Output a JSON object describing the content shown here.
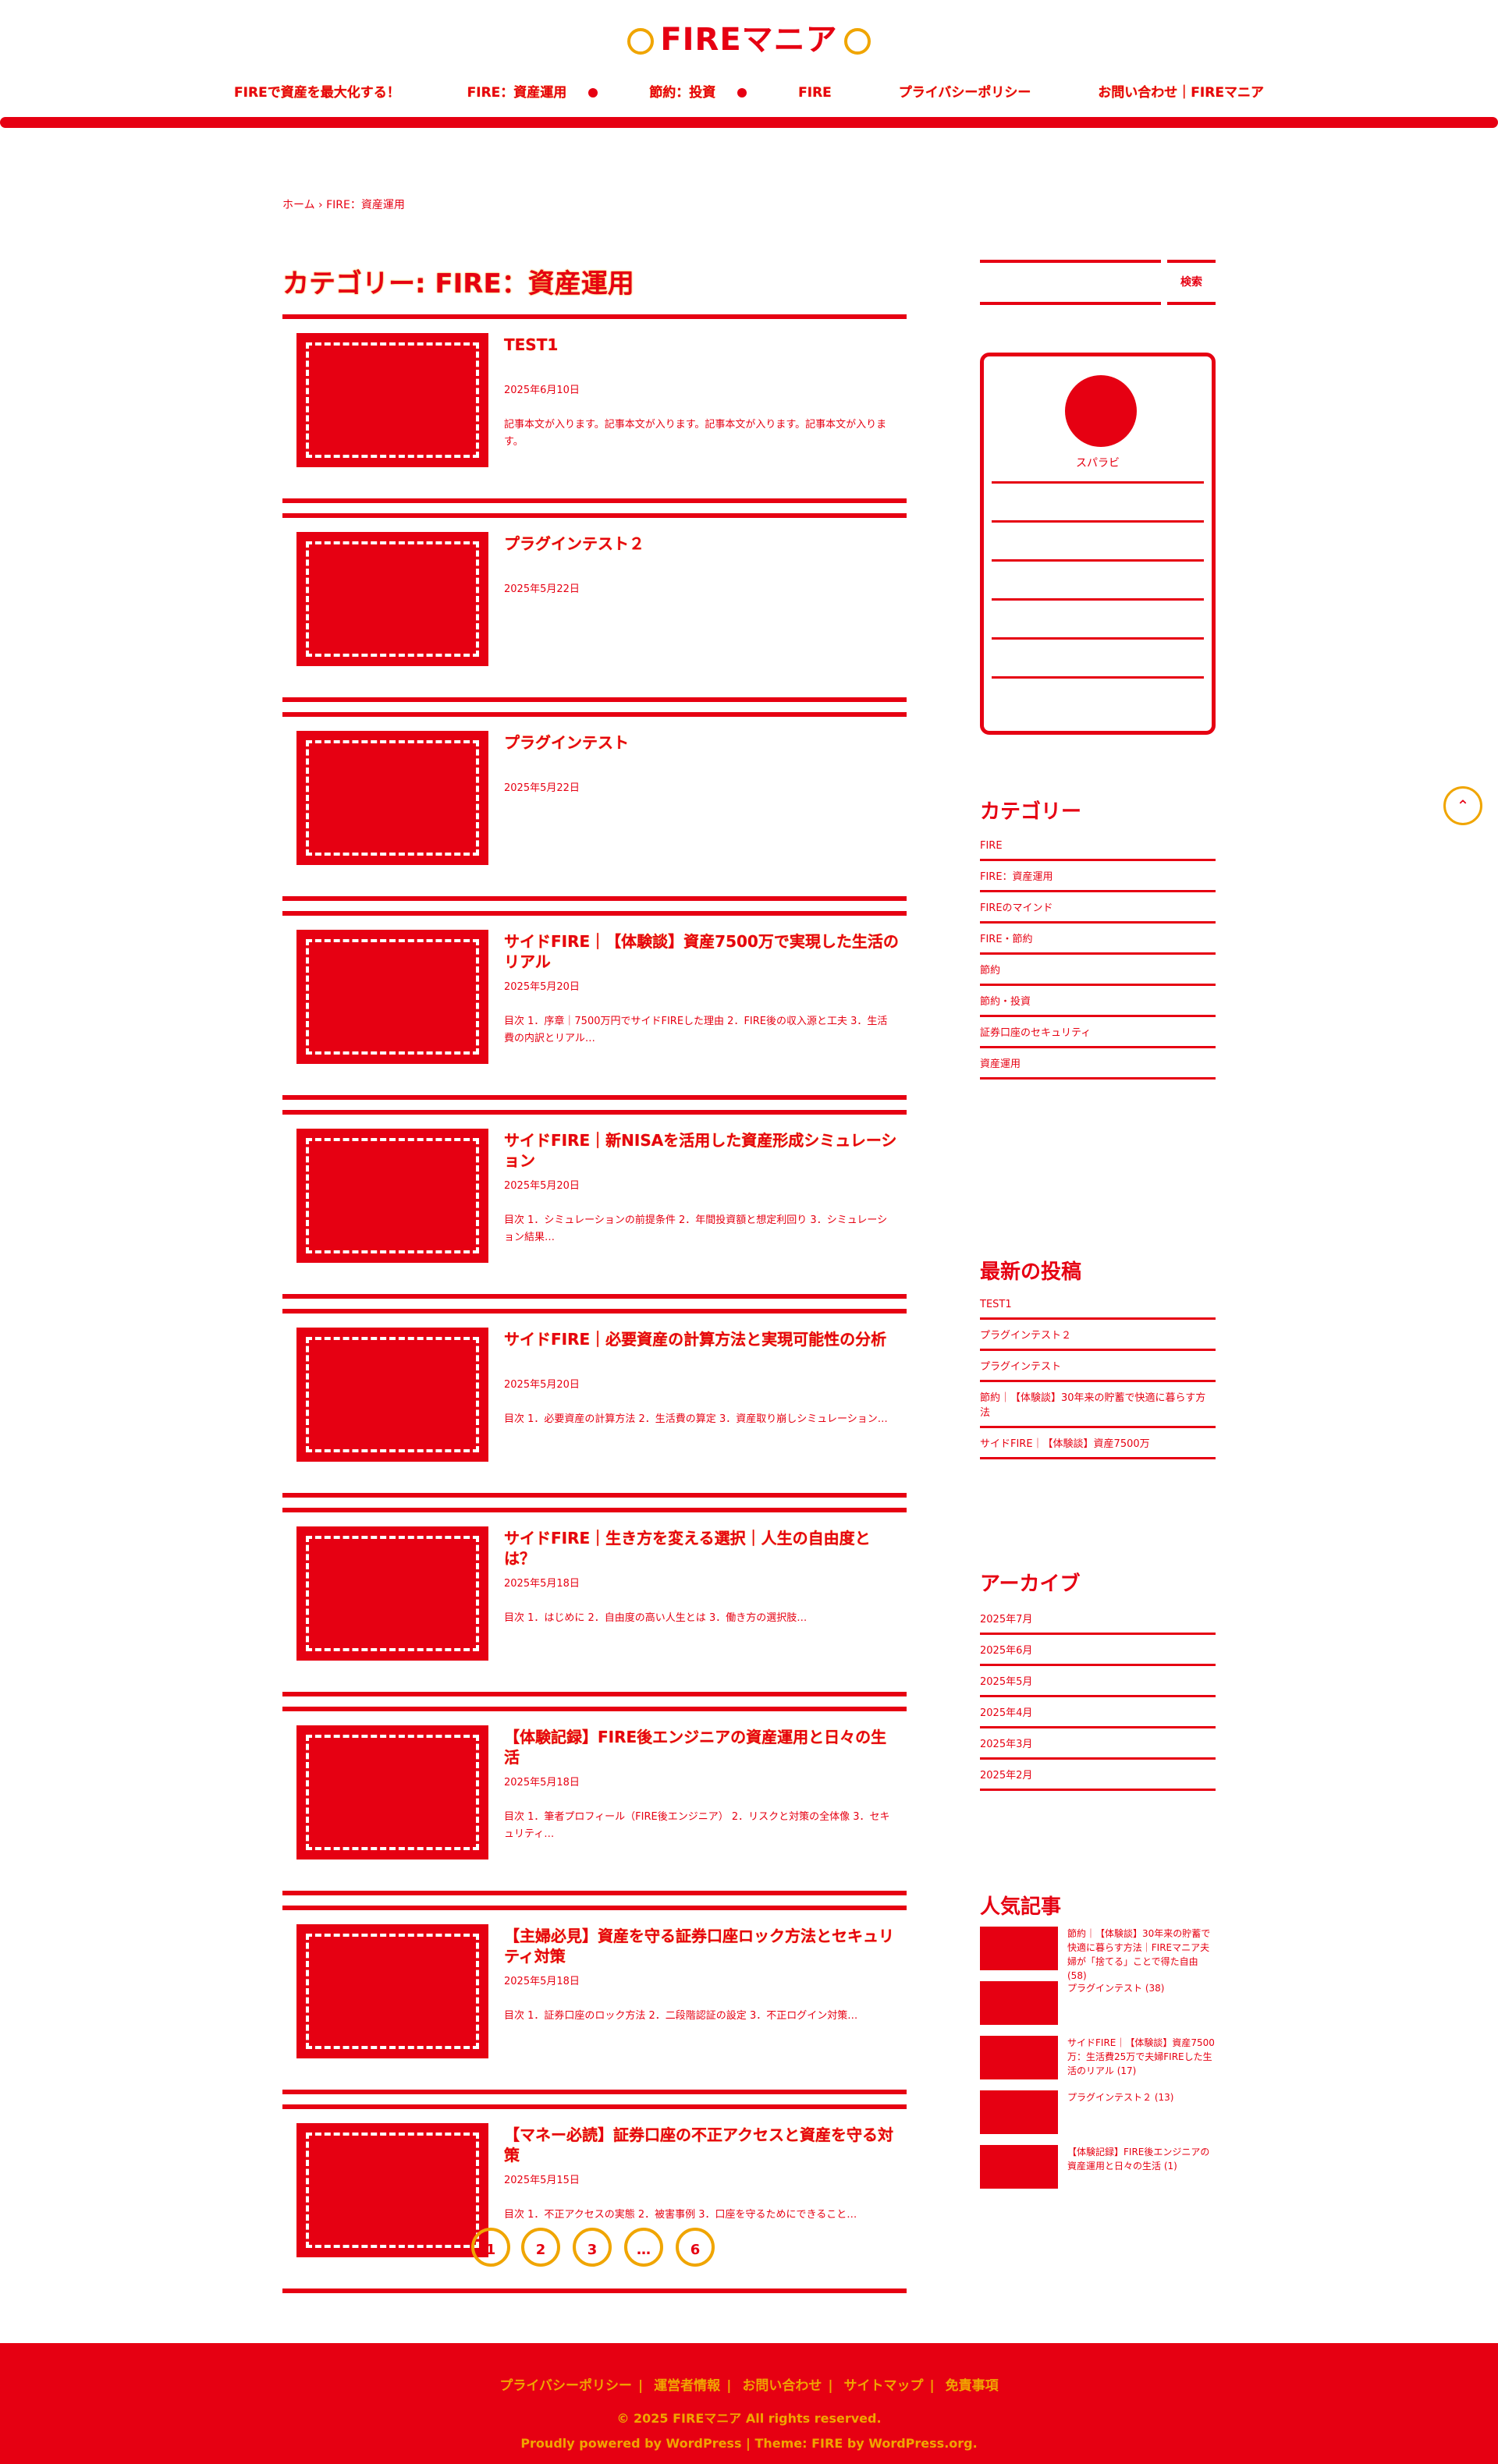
{
  "site": {
    "logo": "FIREマニア"
  },
  "nav": [
    {
      "label": "FIREで資産を最大化する！"
    },
    {
      "label": "FIRE：資産運用",
      "has_dropdown": true
    },
    {
      "label": "節約：投資",
      "has_dropdown": true
    },
    {
      "label": "FIRE"
    },
    {
      "label": "プライバシーポリシー"
    },
    {
      "label": "お問い合わせ｜FIREマニア"
    }
  ],
  "breadcrumb": {
    "home": "ホーム",
    "sep": "›",
    "current": "FIRE：資産運用"
  },
  "category_title": "カテゴリー: FIRE：資産運用",
  "posts": [
    {
      "title": "TEST1",
      "date": "2025年6月10日",
      "excerpt": "記事本文が入ります。記事本文が入ります。記事本文が入ります。記事本文が入ります。"
    },
    {
      "title": "プラグインテスト２",
      "date": "2025年5月22日",
      "excerpt": ""
    },
    {
      "title": "プラグインテスト",
      "date": "2025年5月22日",
      "excerpt": ""
    },
    {
      "title": "サイドFIRE｜【体験談】資産7500万で実現した生活のリアル",
      "date": "2025年5月20日",
      "excerpt": "目次 1．序章｜7500万円でサイドFIREした理由 2．FIRE後の収入源と工夫 3．生活費の内訳とリアル…"
    },
    {
      "title": "サイドFIRE｜新NISAを活用した資産形成シミュレーション",
      "date": "2025年5月20日",
      "excerpt": "目次 1．シミュレーションの前提条件 2．年間投資額と想定利回り 3．シミュレーション結果…"
    },
    {
      "title": "サイドFIRE｜必要資産の計算方法と実現可能性の分析",
      "date": "2025年5月20日",
      "excerpt": "目次 1．必要資産の計算方法 2．生活費の算定 3．資産取り崩しシミュレーション…"
    },
    {
      "title": "サイドFIRE｜生き方を変える選択｜人生の自由度とは？",
      "date": "2025年5月18日",
      "excerpt": "目次 1．はじめに 2．自由度の高い人生とは 3．働き方の選択肢…"
    },
    {
      "title": "【体験記録】FIRE後エンジニアの資産運用と日々の生活",
      "date": "2025年5月18日",
      "excerpt": "目次 1．筆者プロフィール（FIRE後エンジニア） 2．リスクと対策の全体像 3．セキュリティ…"
    },
    {
      "title": "【主婦必見】資産を守る証券口座ロック方法とセキュリティ対策",
      "date": "2025年5月18日",
      "excerpt": "目次 1．証券口座のロック方法 2．二段階認証の設定 3．不正ログイン対策…"
    },
    {
      "title": "【マネー必読】証券口座の不正アクセスと資産を守る対策",
      "date": "2025年5月15日",
      "excerpt": "目次 1．不正アクセスの実態 2．被害事例 3．口座を守るためにできること…"
    }
  ],
  "pager": [
    "1",
    "2",
    "3",
    "…",
    "6"
  ],
  "sidebar": {
    "search_button": "検索",
    "profile_name": "スパラビ",
    "categories_heading": "カテゴリー",
    "categories": [
      "FIRE",
      "FIRE：資産運用",
      "FIREのマインド",
      "FIRE・節約",
      "節約",
      "節約・投資",
      "証券口座のセキュリティ",
      "資産運用"
    ],
    "recent_heading": "最新の投稿",
    "recent": [
      "TEST1",
      "プラグインテスト２",
      "プラグインテスト",
      "節約｜【体験談】30年来の貯蓄で快適に暮らす方法",
      "サイドFIRE｜【体験談】資産7500万"
    ],
    "archive_heading": "アーカイブ",
    "archives": [
      "2025年7月",
      "2025年6月",
      "2025年5月",
      "2025年4月",
      "2025年3月",
      "2025年2月"
    ],
    "popular_heading": "人気記事",
    "popular": [
      {
        "title": "節約｜【体験談】30年来の貯蓄で快適に暮らす方法｜FIREマニア夫婦が「捨てる」ことで得た自由 (58)"
      },
      {
        "title": "プラグインテスト (38)"
      },
      {
        "title": "サイドFIRE｜【体験談】資産7500万：生活費25万で夫婦FIREした生活のリアル (17)"
      },
      {
        "title": "プラグインテスト２ (13)"
      },
      {
        "title": "【体験記録】FIRE後エンジニアの資産運用と日々の生活 (1)"
      }
    ]
  },
  "footer": {
    "links": [
      "プライバシーポリシー",
      "運営者情報",
      "お問い合わせ",
      "サイトマップ",
      "免責事項"
    ],
    "copyright": "© 2025 FIREマニア All rights reserved.",
    "powered": "Proudly powered by WordPress | Theme: FIRE by WordPress.org."
  },
  "colors": {
    "primary": "#e60012",
    "accent": "#f0a500",
    "background": "#ffffff"
  }
}
